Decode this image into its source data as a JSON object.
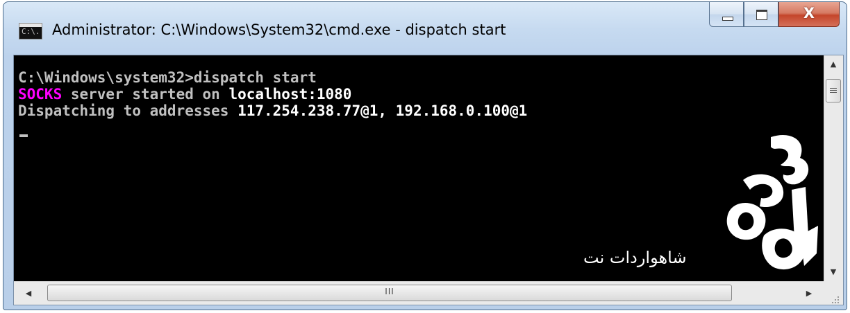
{
  "window": {
    "title": "Administrator: C:\\Windows\\System32\\cmd.exe - dispatch  start",
    "app_icon_text": "C:\\.",
    "buttons": {
      "minimize": "minimize",
      "maximize": "maximize",
      "close_glyph": "X"
    }
  },
  "console": {
    "line1": "C:\\Windows\\system32>dispatch start",
    "line2_highlight": "SOCKS",
    "line2_rest": " server started on ",
    "line2_addr": "localhost:1080",
    "line3_prefix": "Dispatching to addresses ",
    "line3_addresses": "117.254.238.77@1, 192.168.0.100@1",
    "cursor": "_"
  },
  "watermark": {
    "text": "شاهواردات نت"
  },
  "scrollbars": {
    "hthumb_grip": "III"
  },
  "colors": {
    "console_bg": "#000000",
    "console_text": "#c0c0c0",
    "highlight_magenta": "#ff00ff",
    "close_red": "#c5462b"
  }
}
